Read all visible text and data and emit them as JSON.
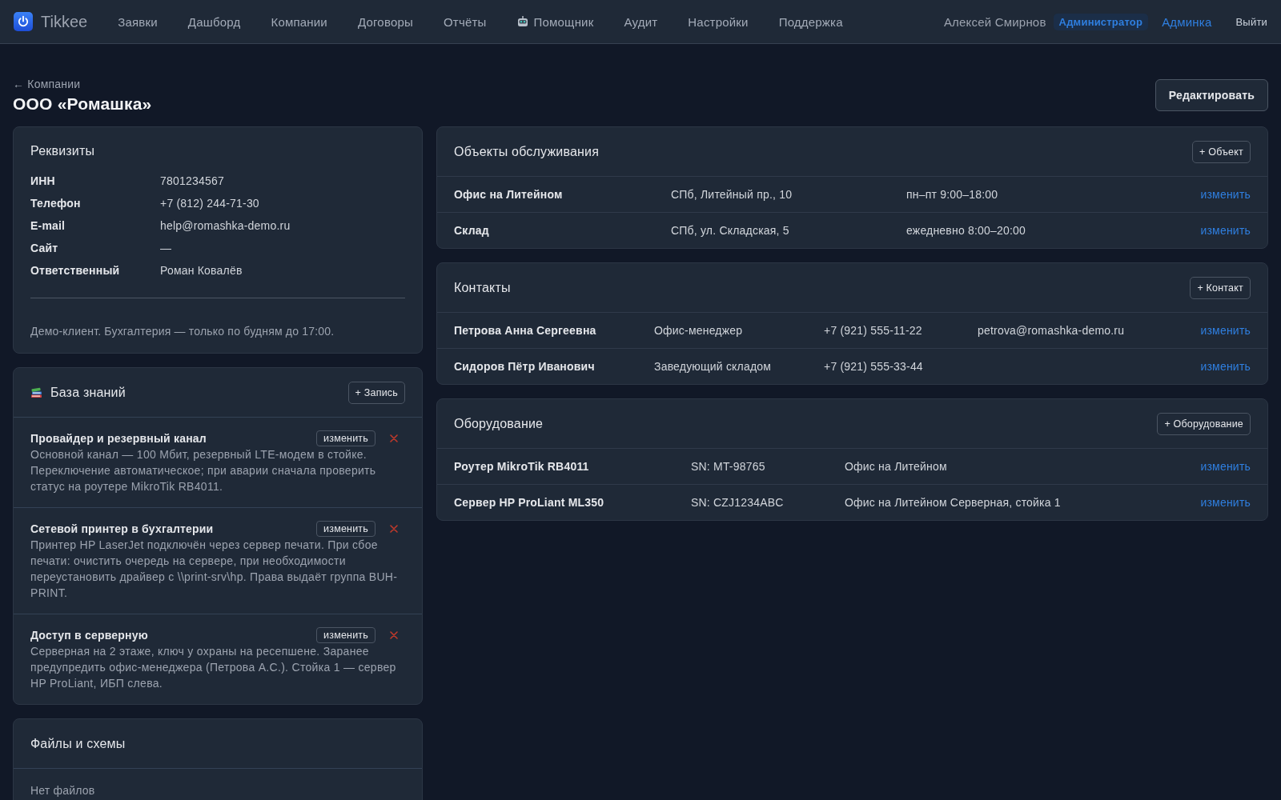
{
  "nav": {
    "brand": "Tikkee",
    "items": [
      {
        "label": "Заявки",
        "kind": "text"
      },
      {
        "label": "Дашборд",
        "kind": "text"
      },
      {
        "label": "Компании",
        "kind": "text"
      },
      {
        "label": "Договоры",
        "kind": "text"
      },
      {
        "label": "Отчёты",
        "kind": "text"
      },
      {
        "label": "Помощник",
        "kind": "robot"
      },
      {
        "label": "Аудит",
        "kind": "text"
      },
      {
        "label": "Настройки",
        "kind": "text"
      },
      {
        "label": "Поддержка",
        "kind": "text"
      }
    ],
    "user": {
      "name": "Алексей Смирнов",
      "role": "Администратор",
      "admin_link": "Админка",
      "logout": "Выйти"
    }
  },
  "header": {
    "back_link": "← Компании",
    "title": "ООО «Ромашка»",
    "edit_button": "Редактировать"
  },
  "requisites": {
    "title": "Реквизиты",
    "fields": [
      {
        "label": "ИНН",
        "value": "7801234567"
      },
      {
        "label": "Телефон",
        "value": "+7 (812) 244-71-30"
      },
      {
        "label": "E-mail",
        "value": "help@romashka-demo.ru"
      },
      {
        "label": "Сайт",
        "value": "—"
      },
      {
        "label": "Ответственный",
        "value": "Роман Ковалёв"
      }
    ],
    "note": "Демо-клиент. Бухгалтерия — только по будням до 17:00."
  },
  "knowledge_base": {
    "title": "База знаний",
    "add_button": "+ Запись",
    "entries": [
      {
        "title": "Провайдер и резервный канал",
        "text": "Основной канал — 100 Мбит, резервный LTE-модем в стойке. Переключение автоматическое; при аварии сначала проверить статус на роутере MikroTik RB4011.",
        "edit_button": "изменить"
      },
      {
        "title": "Сетевой принтер в бухгалтерии",
        "text": "Принтер HP LaserJet подключён через сервер печати. При сбое печати: очистить очередь на сервере, при необходимости переустановить драйвер с \\\\print-srv\\hp. Права выдаёт группа BUH-PRINT.",
        "edit_button": "изменить"
      },
      {
        "title": "Доступ в серверную",
        "text": "Серверная на 2 этаже, ключ у охраны на ресепшене. Заранее предупредить офис-менеджера (Петрова А.С.). Стойка 1 — сервер HP ProLiant, ИБП слева.",
        "edit_button": "изменить"
      }
    ]
  },
  "files": {
    "title": "Файлы и схемы",
    "empty_text": "Нет файлов"
  },
  "objects": {
    "title": "Объекты обслуживания",
    "add_button": "+ Объект",
    "rows": [
      {
        "name": "Офис на Литейном",
        "address": "СПб, Литейный пр., 10",
        "hours": "пн–пт 9:00–18:00",
        "edit_link": "изменить"
      },
      {
        "name": "Склад",
        "address": "СПб, ул. Складская, 5",
        "hours": "ежедневно 8:00–20:00",
        "edit_link": "изменить"
      }
    ]
  },
  "contacts": {
    "title": "Контакты",
    "add_button": "+ Контакт",
    "rows": [
      {
        "name": "Петрова Анна Сергеевна",
        "position": "Офис-менеджер",
        "phone": "+7 (921) 555-11-22",
        "email": "petrova@romashka-demo.ru",
        "edit_link": "изменить"
      },
      {
        "name": "Сидоров Пётр Иванович",
        "position": "Заведующий складом",
        "phone": "+7 (921) 555-33-44",
        "edit_link": "изменить"
      }
    ]
  },
  "equipment": {
    "title": "Оборудование",
    "add_button": "+ Оборудование",
    "rows": [
      {
        "name": "Роутер MikroTik RB4011",
        "serial": "SN: MT-98765",
        "location": "Офис на Литейном",
        "edit_link": "изменить"
      },
      {
        "name": "Сервер HP ProLiant ML350",
        "serial": "SN: CZJ1234ABC",
        "location": "Офис на Литейном Серверная, стойка 1",
        "edit_link": "изменить"
      }
    ]
  }
}
